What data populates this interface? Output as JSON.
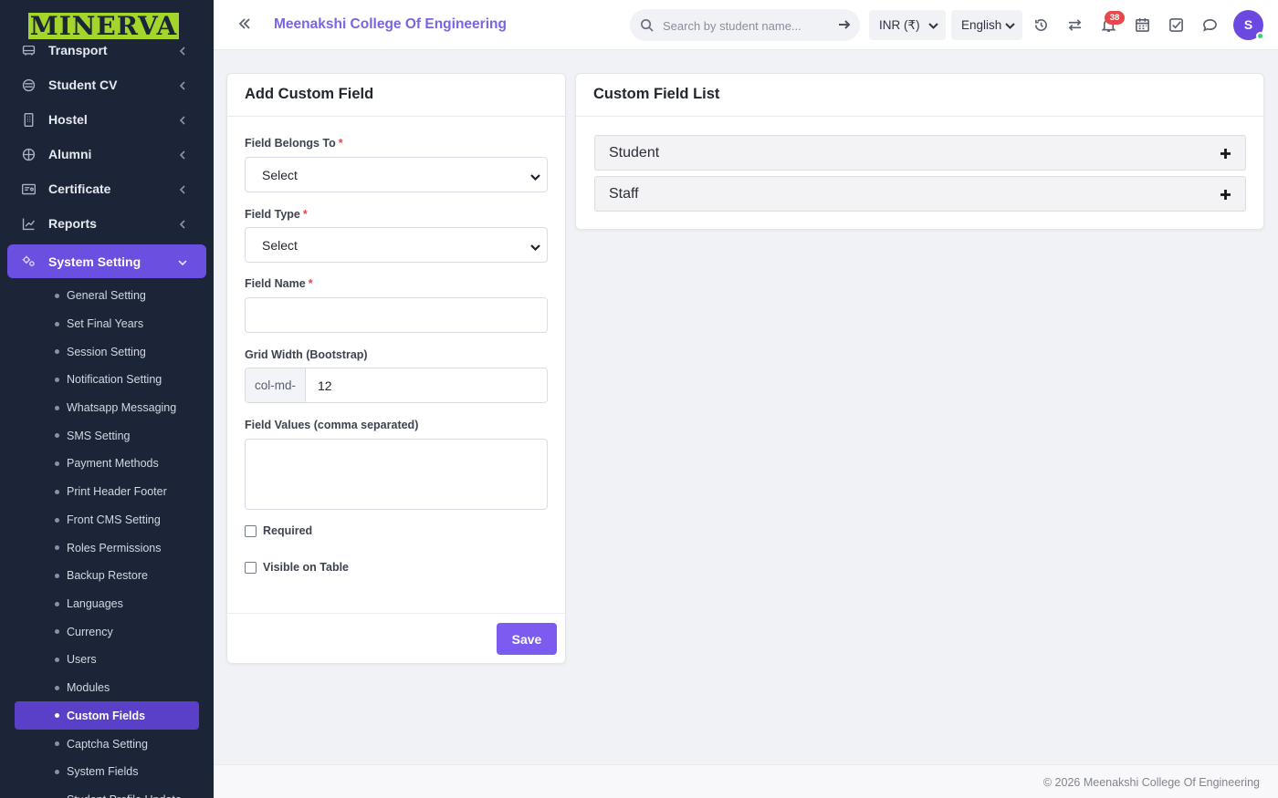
{
  "brand": {
    "logo_text": "MINERVA"
  },
  "sidebar": {
    "items": [
      {
        "label": "Transport",
        "icon": "bus-icon"
      },
      {
        "label": "Student CV",
        "icon": "layers-icon"
      },
      {
        "label": "Hostel",
        "icon": "building-icon"
      },
      {
        "label": "Alumni",
        "icon": "globe-icon"
      },
      {
        "label": "Certificate",
        "icon": "certificate-icon"
      },
      {
        "label": "Reports",
        "icon": "chart-line-icon"
      }
    ],
    "active_item": {
      "label": "System Setting",
      "icon": "gears-icon"
    },
    "submenu": [
      "General Setting",
      "Set Final Years",
      "Session Setting",
      "Notification Setting",
      "Whatsapp Messaging",
      "SMS Setting",
      "Payment Methods",
      "Print Header Footer",
      "Front CMS Setting",
      "Roles Permissions",
      "Backup Restore",
      "Languages",
      "Currency",
      "Users",
      "Modules",
      "Custom Fields",
      "Captcha Setting",
      "System Fields",
      "Student Profile Update"
    ],
    "active_submenu": "Custom Fields"
  },
  "header": {
    "title": "Meenakshi College Of Engineering",
    "search_placeholder": "Search by student name...",
    "currency": "INR (₹)",
    "language": "English",
    "notification_count": "38",
    "avatar_initial": "S"
  },
  "form": {
    "title": "Add Custom Field",
    "belongs_label": "Field Belongs To",
    "belongs_value": "Select",
    "type_label": "Field Type",
    "type_value": "Select",
    "name_label": "Field Name",
    "name_value": "",
    "grid_label": "Grid Width (Bootstrap)",
    "grid_prefix": "col-md-",
    "grid_value": "12",
    "values_label": "Field Values (comma separated)",
    "required_label": "Required",
    "visible_label": "Visible on Table",
    "save_label": "Save",
    "required_mark": "*"
  },
  "list": {
    "title": "Custom Field List",
    "groups": [
      "Student",
      "Staff"
    ]
  },
  "footer": {
    "copyright": "© 2026 Meenakshi College Of Engineering"
  },
  "colors": {
    "accent": "#7c5cf0",
    "sidebar_bg": "#1c2537",
    "active_menu": "#6a4fe0",
    "logo_bg": "#a4d52a",
    "badge": "#e5484d"
  }
}
